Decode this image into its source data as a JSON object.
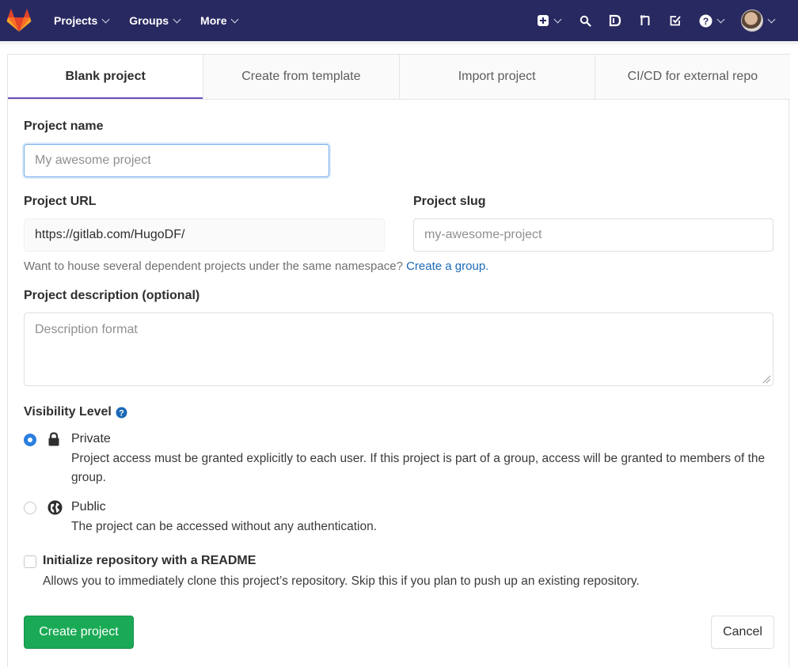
{
  "navbar": {
    "menu": [
      {
        "label": "Projects"
      },
      {
        "label": "Groups"
      },
      {
        "label": "More"
      }
    ],
    "icons": [
      "plus-square-icon",
      "search-icon",
      "issues-icon",
      "merge-request-icon",
      "todo-icon",
      "help-icon",
      "avatar"
    ]
  },
  "tabs": [
    {
      "label": "Blank project",
      "active": true
    },
    {
      "label": "Create from template",
      "active": false
    },
    {
      "label": "Import project",
      "active": false
    },
    {
      "label": "CI/CD for external repo",
      "active": false
    }
  ],
  "form": {
    "project_name": {
      "label": "Project name",
      "placeholder": "My awesome project",
      "value": ""
    },
    "project_url": {
      "label": "Project URL",
      "value": "https://gitlab.com/HugoDF/"
    },
    "project_slug": {
      "label": "Project slug",
      "placeholder": "my-awesome-project",
      "value": ""
    },
    "namespace_help": {
      "text": "Want to house several dependent projects under the same namespace?",
      "link": "Create a group."
    },
    "description": {
      "label": "Project description (optional)",
      "placeholder": "Description format"
    },
    "visibility": {
      "label": "Visibility Level",
      "options": [
        {
          "title": "Private",
          "icon": "lock-icon",
          "checked": true,
          "description": "Project access must be granted explicitly to each user. If this project is part of a group, access will be granted to members of the group."
        },
        {
          "title": "Public",
          "icon": "globe-icon",
          "checked": false,
          "description": "The project can be accessed without any authentication."
        }
      ]
    },
    "readme": {
      "label": "Initialize repository with a README",
      "checked": false,
      "description": "Allows you to immediately clone this project’s repository. Skip this if you plan to push up an existing repository."
    }
  },
  "actions": {
    "create_label": "Create project",
    "cancel_label": "Cancel"
  },
  "colors": {
    "navbar": "#292961",
    "accent_tab": "#6b4fbb",
    "primary_button": "#1aaa55",
    "link": "#1b69b6",
    "radio_checked": "#2a7fe0"
  }
}
